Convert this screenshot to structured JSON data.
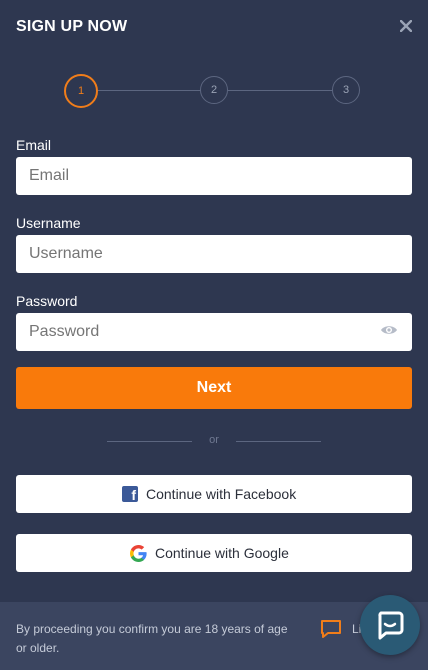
{
  "header": {
    "title": "SIGN UP NOW",
    "close_glyph": "✕"
  },
  "stepper": {
    "steps": [
      "1",
      "2",
      "3"
    ],
    "active_step": 1
  },
  "form": {
    "email": {
      "label": "Email",
      "placeholder": "Email"
    },
    "username": {
      "label": "Username",
      "placeholder": "Username"
    },
    "password": {
      "label": "Password",
      "placeholder": "Password"
    },
    "next_label": "Next"
  },
  "divider": {
    "text": "or"
  },
  "social": {
    "facebook_label": "Continue with Facebook",
    "google_label": "Continue with Google"
  },
  "footer": {
    "notice": "By proceeding you confirm you are 18 years of age or older.",
    "chat_label": "Li"
  },
  "colors": {
    "background": "#2e3750",
    "accent": "#f97a0b",
    "facebook": "#3b5998",
    "chat_bubble": "#2a5a75"
  },
  "icons": [
    "close-icon",
    "eye-icon",
    "facebook-icon",
    "google-icon",
    "chat-icon",
    "live-chat-icon"
  ]
}
